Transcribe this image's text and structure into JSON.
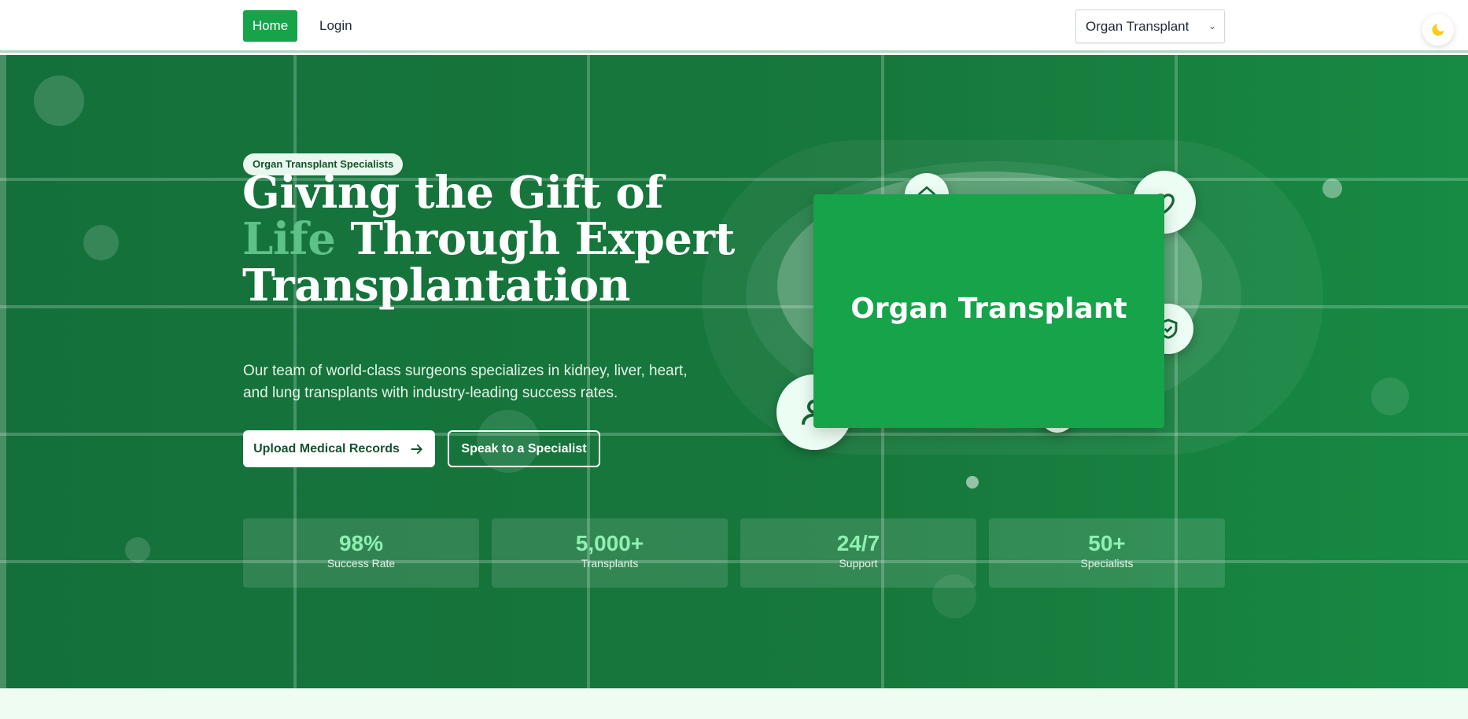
{
  "nav": {
    "home_label": "Home",
    "login_label": "Login",
    "select_value": "Organ Transplant"
  },
  "hero": {
    "badge": "Organ Transplant Specialists",
    "headline_line1": "Giving the Gift of",
    "headline_highlight": "Life",
    "headline_rest": " Through Expert",
    "headline_line3": "Transplantation",
    "subtext": "Our team of world-class surgeons specializes in kidney, liver, heart, and lung transplants with industry-leading success rates.",
    "upload_button": "Upload Medical Records",
    "speak_button": "Speak to a Specialist",
    "feature_card_title": "Organ Transplant"
  },
  "stats": [
    {
      "value": "98%",
      "label": "Success Rate"
    },
    {
      "value": "5,000+",
      "label": "Transplants"
    },
    {
      "value": "24/7",
      "label": "Support"
    },
    {
      "value": "50+",
      "label": "Specialists"
    }
  ],
  "icons": {
    "theme": "moon-icon",
    "upload_arrow": "arrow-right-icon",
    "orbit": [
      "home-icon",
      "heart-icon",
      "shield-icon",
      "user-icon",
      "circle-icon"
    ]
  },
  "colors": {
    "primary": "#16a34a",
    "hero_bg": "#17783c",
    "highlight": "#5ec187",
    "stat_value": "#8ff0b2",
    "moon": "#facc15"
  }
}
